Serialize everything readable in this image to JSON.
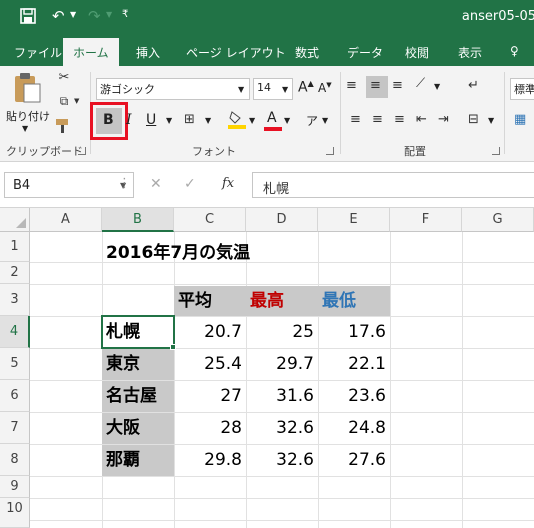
{
  "title_bar": {
    "file_name": "anser05-05",
    "customize_glyph": "₹"
  },
  "tabs": [
    {
      "label": "ファイル"
    },
    {
      "label": "ホーム"
    },
    {
      "label": "挿入"
    },
    {
      "label": "ページ レイアウト"
    },
    {
      "label": "数式"
    },
    {
      "label": "データ"
    },
    {
      "label": "校閲"
    },
    {
      "label": "表示"
    },
    {
      "label": "♀"
    }
  ],
  "ribbon": {
    "clipboard": {
      "paste_label": "貼り付け",
      "group_label": "クリップボード"
    },
    "font": {
      "font_name": "游ゴシック",
      "font_size": "14",
      "grow_label": "A",
      "shrink_label": "A",
      "bold_label": "B",
      "italic_label": "I",
      "underline_label": "U",
      "font_color_label": "A",
      "phonetic_label": "ア",
      "group_label": "フォント",
      "font_color": "#e81123",
      "fill_color": "#ffd400"
    },
    "alignment": {
      "group_label": "配置"
    },
    "number": {
      "format_label": "標準"
    }
  },
  "formula_bar": {
    "name_box": "B4",
    "formula": "札幌"
  },
  "columns": [
    "A",
    "B",
    "C",
    "D",
    "E",
    "F",
    "G"
  ],
  "rows": [
    "1",
    "2",
    "3",
    "4",
    "5",
    "6",
    "7",
    "8",
    "9",
    "10"
  ],
  "sheet": {
    "title": "2016年7月の気温",
    "headers": [
      {
        "label": "平均",
        "color": "#000000"
      },
      {
        "label": "最高",
        "color": "#c00000"
      },
      {
        "label": "最低",
        "color": "#2f75b5"
      }
    ],
    "data_rows": [
      {
        "city": "札幌",
        "avg": "20.7",
        "high": "25",
        "low": "17.6"
      },
      {
        "city": "東京",
        "avg": "25.4",
        "high": "29.7",
        "low": "22.1"
      },
      {
        "city": "名古屋",
        "avg": "27",
        "high": "31.6",
        "low": "23.6"
      },
      {
        "city": "大阪",
        "avg": "28",
        "high": "32.6",
        "low": "24.8"
      },
      {
        "city": "那覇",
        "avg": "29.8",
        "high": "32.6",
        "low": "27.6"
      }
    ]
  },
  "colors": {
    "excel_green": "#217346",
    "highlight_red": "#e81123",
    "header_gray": "#c9c9c9"
  }
}
